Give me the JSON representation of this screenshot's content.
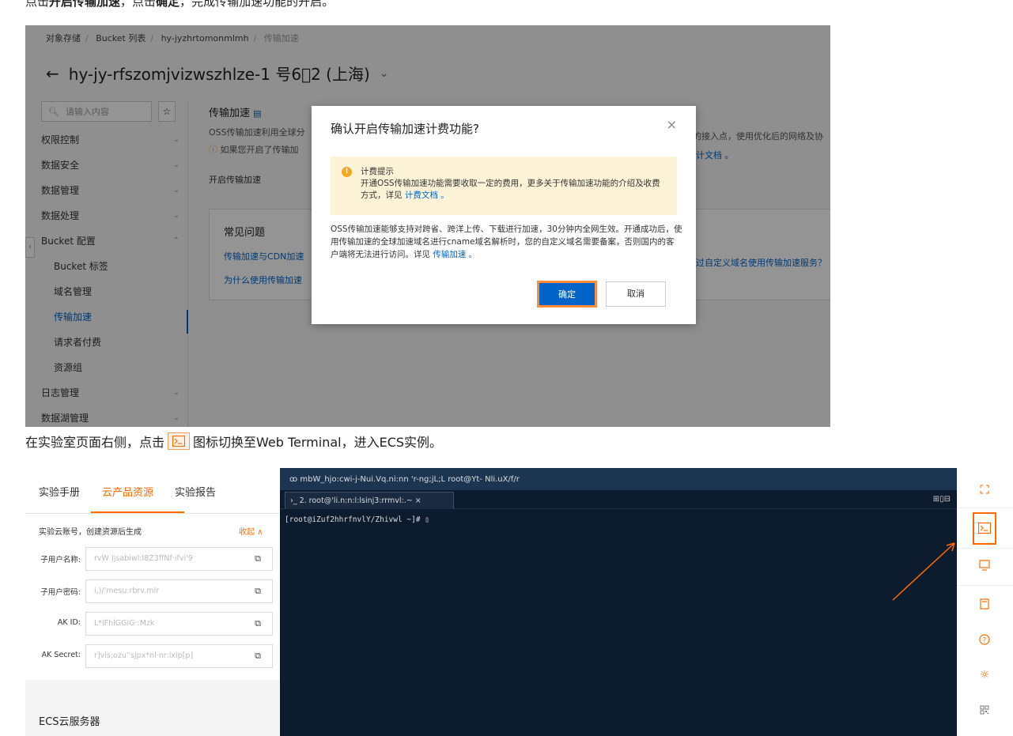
{
  "instructions": {
    "step1": {
      "pre": "点击",
      "b1": "开启传输加速",
      "mid": "，点击",
      "b2": "确定",
      "post": "，完成传输加速功能的开启。"
    },
    "step2": {
      "pre": "在实验室页面右侧，点击",
      "post": "图标切换至Web Terminal，进入ECS实例。"
    }
  },
  "console": {
    "breadcrumb": [
      "对象存储",
      "Bucket 列表",
      "hy-jyzhrtomonmlmh",
      "传输加速"
    ],
    "bucket_title": "hy-jy-rfszomjvizwszhlze-1 号6⃣2 (上海)",
    "search_placeholder": "请输入内容",
    "nav": [
      {
        "label": "权限控制",
        "chev": "⌄"
      },
      {
        "label": "数据安全",
        "chev": "⌄"
      },
      {
        "label": "数据管理",
        "chev": "⌄"
      },
      {
        "label": "数据处理",
        "chev": "⌄"
      },
      {
        "label": "Bucket 配置",
        "chev": "⌃"
      },
      {
        "label": "Bucket 标签",
        "chev": ""
      },
      {
        "label": "域名管理",
        "chev": ""
      },
      {
        "label": "传输加速",
        "chev": ""
      },
      {
        "label": "请求者付费",
        "chev": ""
      },
      {
        "label": "资源组",
        "chev": ""
      },
      {
        "label": "日志管理",
        "chev": "⌄"
      },
      {
        "label": "数据湖管理",
        "chev": "⌄"
      }
    ],
    "main_title": "传输加速",
    "main_desc": "OSS传输加速利用全球分",
    "main_warn": "如果您开启了传输加",
    "main_open_label": "开启传输加速",
    "right_desc": "的接入点，使用优化后的网络及协",
    "right_doc": "计文档 。",
    "faq_title": "常见问题",
    "faq_links": [
      "传输加速与CDN加速",
      "为什么使用传输加速"
    ],
    "faq_right": "过自定义域名使用传输加速服务？"
  },
  "modal": {
    "title": "确认开启传输加速计费功能?",
    "close": "×",
    "notice_title": "计费提示",
    "notice_body": "开通OSS传输加速功能需要收取一定的费用，更多关于传输加速功能的介绍及收费方式，详见",
    "notice_link": "计费文档 。",
    "body_text": "OSS传输加速能够支持对跨省、跨洋上传、下载进行加速，30分钟内全网生效。开通成功后，使用传输加速的全球加速域名进行cname域名解析时，您的自定义域名需要备案，否则国内的客户端将无法进行访问。详见",
    "body_link": "传输加速 。",
    "ok": "确定",
    "cancel": "取消"
  },
  "lab": {
    "tabs": [
      "实验手册",
      "云产品资源",
      "实验报告"
    ],
    "active_tab": "云产品资源",
    "hint": "实验云账号，创建资源后生成",
    "collapse": "收起 ∧",
    "fields": [
      {
        "label": "子用户名称:",
        "value": "rvW Ijsabiwl:I8Z3ffNf·ifvi'9"
      },
      {
        "label": "子用户密码:",
        "value": "i,)/'mesu:rbrv.mlr"
      },
      {
        "label": "AK ID:",
        "value": "L*lFhlGGiG·:Mzk"
      },
      {
        "label": "AK Secret:",
        "value": "r]vis;ozu''sjpx*nl·nr:lxip[p]"
      }
    ],
    "copy_icon": "⧉",
    "ecs_title": "ECS云服务器"
  },
  "terminal": {
    "title": "ꝏ  mbW_hjo:cwi-j-Nui.Vq.ni:nn  'r-ng;jL;L  root@Yt- Nli.uX/f/r",
    "tab": "›_  2. root@'li.n:n:l:lsinj3:rrmvl:.~ ×",
    "prompt": "[root@iZuf2hhrfnvlY/Zhivwl ~]# ▯",
    "controls": "⊞▯⊟"
  }
}
